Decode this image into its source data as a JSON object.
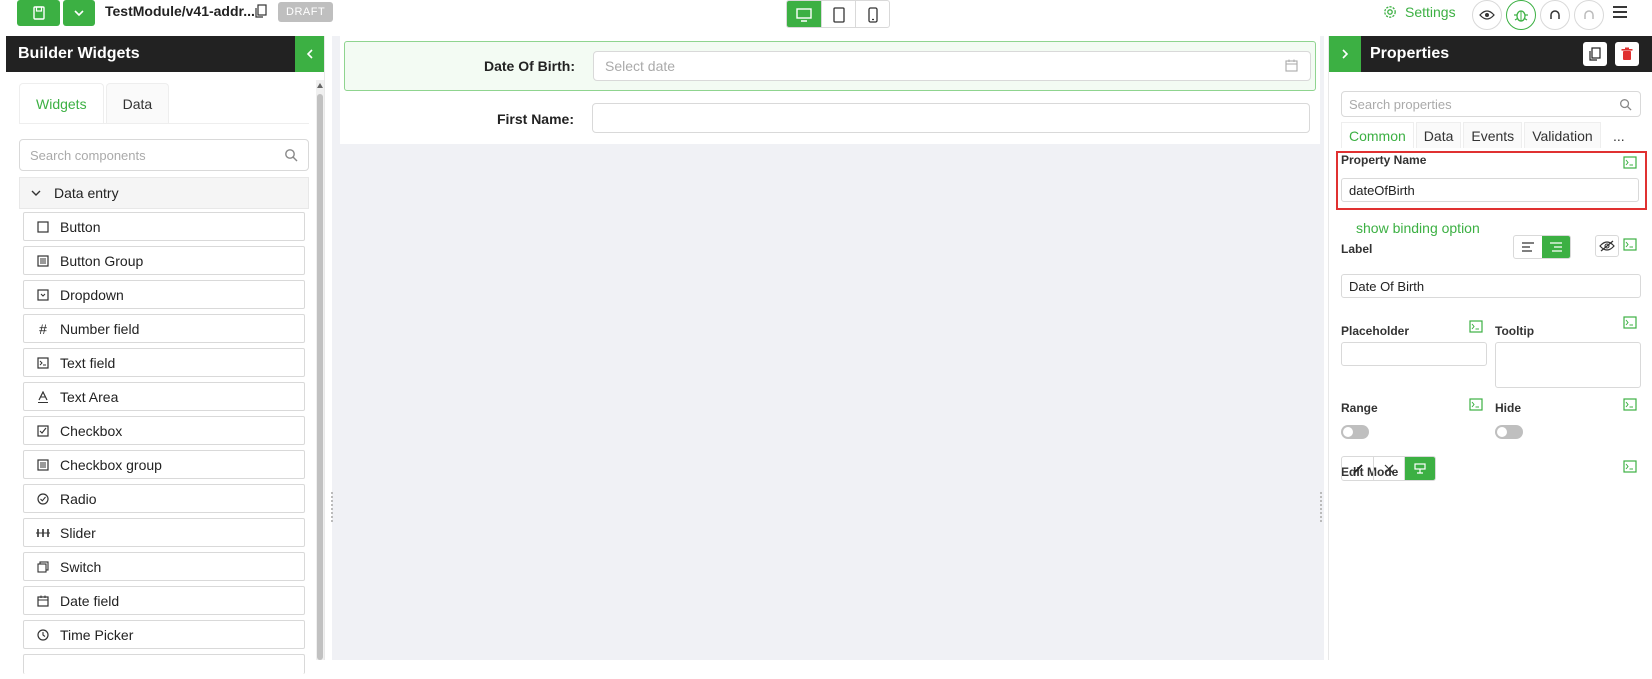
{
  "topbar": {
    "module_title": "TestModule/v41-addr...",
    "status_badge": "DRAFT",
    "settings_label": "Settings"
  },
  "left_panel": {
    "title": "Builder Widgets",
    "tabs": [
      {
        "label": "Widgets",
        "active": true
      },
      {
        "label": "Data",
        "active": false
      }
    ],
    "search_placeholder": "Search components",
    "category": "Data entry",
    "widgets": [
      {
        "label": "Button",
        "icon": "square-icon"
      },
      {
        "label": "Button Group",
        "icon": "button-group-icon"
      },
      {
        "label": "Dropdown",
        "icon": "dropdown-icon"
      },
      {
        "label": "Number field",
        "icon": "hash-icon"
      },
      {
        "label": "Text field",
        "icon": "terminal-icon"
      },
      {
        "label": "Text Area",
        "icon": "text-a-icon"
      },
      {
        "label": "Checkbox",
        "icon": "checkbox-icon"
      },
      {
        "label": "Checkbox group",
        "icon": "checklist-icon"
      },
      {
        "label": "Radio",
        "icon": "radio-icon"
      },
      {
        "label": "Slider",
        "icon": "slider-icon"
      },
      {
        "label": "Switch",
        "icon": "switch-icon"
      },
      {
        "label": "Date field",
        "icon": "calendar-icon"
      },
      {
        "label": "Time Picker",
        "icon": "clock-icon"
      }
    ]
  },
  "canvas": {
    "fields": [
      {
        "label": "Date Of Birth",
        "placeholder": "Select date",
        "selected": true
      },
      {
        "label": "First Name",
        "placeholder": "",
        "selected": false
      }
    ]
  },
  "right_panel": {
    "title": "Properties",
    "search_placeholder": "Search properties",
    "tabs": [
      {
        "label": "Common",
        "active": true
      },
      {
        "label": "Data",
        "active": false
      },
      {
        "label": "Events",
        "active": false
      },
      {
        "label": "Validation",
        "active": false
      }
    ],
    "more": "...",
    "property_name_label": "Property Name",
    "property_name_value": "dateOfBirth",
    "binding_link": "show binding option",
    "label_label": "Label",
    "label_value": "Date Of Birth",
    "placeholder_label": "Placeholder",
    "placeholder_value": "",
    "tooltip_label": "Tooltip",
    "tooltip_value": "",
    "range_label": "Range",
    "range_on": false,
    "hide_label": "Hide",
    "hide_on": false,
    "edit_mode_label": "Edit Mode"
  },
  "colors": {
    "accent": "#3cb043",
    "dark_header": "#222222",
    "highlight_border": "#e03131"
  }
}
